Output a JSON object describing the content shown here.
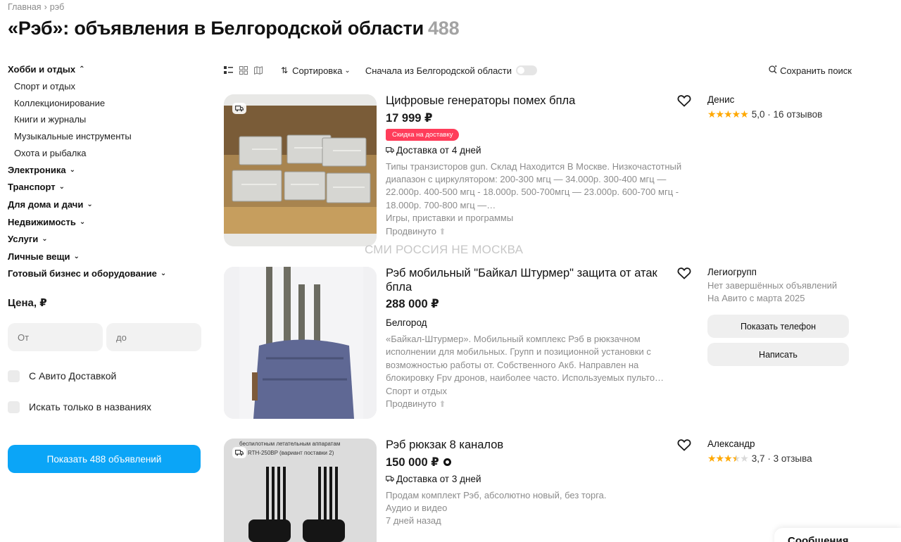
{
  "breadcrumb": {
    "home": "Главная",
    "sep": "›",
    "current": "рэб"
  },
  "page": {
    "title": "«Рэб»: объявления в Белгородской области",
    "count": "488"
  },
  "sidebar": {
    "categories": [
      {
        "label": "Хобби и отдых",
        "chevron": "⌃"
      },
      {
        "label": "Электроника",
        "chevron": "⌄"
      },
      {
        "label": "Транспорт",
        "chevron": "⌄"
      },
      {
        "label": "Для дома и дачи",
        "chevron": "⌄"
      },
      {
        "label": "Недвижимость",
        "chevron": "⌄"
      },
      {
        "label": "Услуги",
        "chevron": "⌄"
      },
      {
        "label": "Личные вещи",
        "chevron": "⌄"
      },
      {
        "label": "Готовый бизнес и оборудование",
        "chevron": "⌄"
      }
    ],
    "subcategories": [
      "Спорт и отдых",
      "Коллекционирование",
      "Книги и журналы",
      "Музыкальные инструменты",
      "Охота и рыбалка"
    ],
    "price": {
      "title": "Цена, ₽",
      "from_placeholder": "От",
      "to_placeholder": "до"
    },
    "checkboxes": {
      "delivery": "С Авито Доставкой",
      "titles_only": "Искать только в названиях"
    },
    "show_button": "Показать 488 объявлений"
  },
  "toolbar": {
    "sort_label": "Сортировка",
    "region_label": "Сначала из Белгородской области",
    "save_search": "Сохранить поиск"
  },
  "listings": [
    {
      "title": "Цифровые генераторы помех бпла",
      "price": "17 999 ₽",
      "discount_badge": "Скидка на доставку",
      "delivery": "Доставка от 4 дней",
      "description": "Типы транзисторов gun. Склад Находится В Москве. Низкочастотный диапазон с циркулятором: 200-300 мгц — 34.000р. 300-400 мгц — 22.000р. 400-500 мгц - 18.000р. 500-700мгц — 23.000р. 600-700 мгц - 18.000р. 700-800 мгц —…",
      "category": "Игры, приставки и программы",
      "promo": "Продвинуто",
      "seller": {
        "name": "Денис",
        "rating": "5,0",
        "reviews": "16 отзывов",
        "stars": 5
      }
    },
    {
      "title": "Рэб мобильный \"Байкал Штурмер\" защита от атак бпла",
      "price": "288 000 ₽",
      "location": "Белгород",
      "description": "«Байкал-Штурмер». Мобильный комплекс Рэб в рюкзачном исполнении для мобильных. Групп и позиционной установки с возможностью работы от. Собственного Акб. Направлен на блокировку Fpv дронов, наиболее часто. Используемых пульто…",
      "category": "Спорт и отдых",
      "promo": "Продвинуто",
      "seller": {
        "name": "Легиогрупп",
        "no_listings": "Нет завершённых объявлений",
        "since": "На Авито с марта 2025",
        "phone_button": "Показать телефон",
        "write_button": "Написать"
      }
    },
    {
      "title": "Рэб рюкзак 8 каналов",
      "price": "150 000 ₽",
      "delivery": "Доставка от 3 дней",
      "description": "Продам комплект Рэб, абсолютно новый, без торга.",
      "category": "Аудио и видео",
      "date": "7 дней назад",
      "photo_caption_1": "беспилотным летательным аппаратам",
      "photo_caption_2": "RTH-250BP (вариант поставки 2)",
      "seller": {
        "name": "Александр",
        "rating": "3,7",
        "reviews": "3 отзыва",
        "stars": 3.5
      }
    }
  ],
  "watermark": "СМИ РОССИЯ НЕ МОСКВА",
  "messages_panel": "Сообщения",
  "colors": {
    "accent": "#0BA5F7",
    "discount": "#FF3D5A",
    "star": "#FFA800"
  }
}
